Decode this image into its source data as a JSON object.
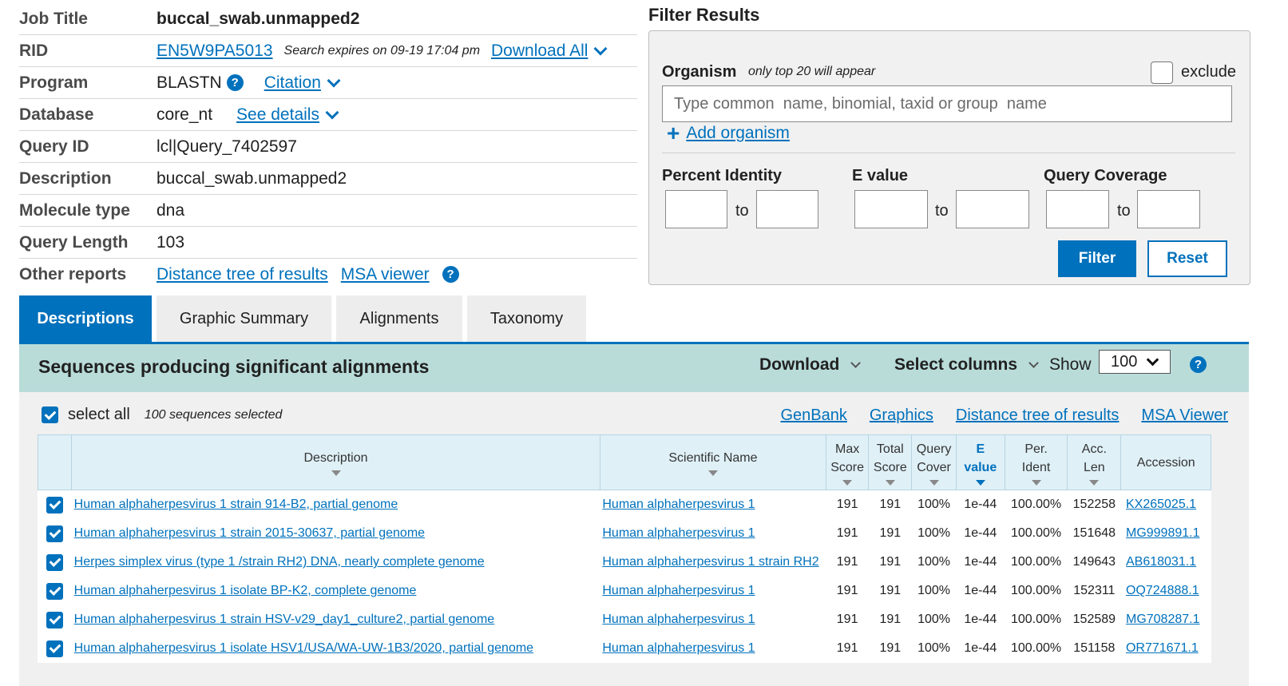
{
  "summary": {
    "job_title_label": "Job Title",
    "job_title": "buccal_swab.unmapped2",
    "rid_label": "RID",
    "rid": "EN5W9PA5013",
    "rid_expires": "Search expires on 09-19 17:04 pm",
    "download_all": "Download All",
    "program_label": "Program",
    "program": "BLASTN",
    "citation": "Citation",
    "database_label": "Database",
    "database": "core_nt",
    "see_details": "See details",
    "query_id_label": "Query ID",
    "query_id": "lcl|Query_7402597",
    "description_label": "Description",
    "description": "buccal_swab.unmapped2",
    "molecule_label": "Molecule type",
    "molecule": "dna",
    "query_length_label": "Query Length",
    "query_length": "103",
    "other_reports_label": "Other reports",
    "distance_tree": "Distance tree of results",
    "msa_viewer": "MSA viewer"
  },
  "filter": {
    "title": "Filter Results",
    "organism_label": "Organism",
    "organism_hint": "only top 20 will appear",
    "exclude_label": "exclude",
    "organism_placeholder": "Type common  name, binomial, taxid or group  name",
    "add_organism": "Add organism",
    "percent_identity": "Percent Identity",
    "e_value": "E value",
    "query_coverage": "Query Coverage",
    "to": "to",
    "filter_button": "Filter",
    "reset_button": "Reset"
  },
  "tabs": [
    {
      "label": "Descriptions",
      "active": true
    },
    {
      "label": "Graphic Summary",
      "active": false
    },
    {
      "label": "Alignments",
      "active": false
    },
    {
      "label": "Taxonomy",
      "active": false
    }
  ],
  "results": {
    "title": "Sequences producing significant alignments",
    "download": "Download",
    "select_columns": "Select columns",
    "show_label": "Show",
    "show_value": "100",
    "select_all": "select all",
    "selected_count": "100 sequences selected",
    "links": [
      "GenBank",
      "Graphics",
      "Distance tree of results",
      "MSA Viewer"
    ],
    "columns": {
      "description": "Description",
      "scientific_name": "Scientific Name",
      "max_score_1": "Max",
      "max_score_2": "Score",
      "total_score_1": "Total",
      "total_score_2": "Score",
      "query_cover_1": "Query",
      "query_cover_2": "Cover",
      "e_value_1": "E",
      "e_value_2": "value",
      "per_ident_1": "Per.",
      "per_ident_2": "Ident",
      "acc_len_1": "Acc.",
      "acc_len_2": "Len",
      "accession": "Accession"
    },
    "rows": [
      {
        "description": "Human alphaherpesvirus 1 strain 914-B2, partial genome",
        "scientific_name": "Human alphaherpesvirus 1",
        "max_score": "191",
        "total_score": "191",
        "query_cover": "100%",
        "e_value": "1e-44",
        "per_ident": "100.00%",
        "acc_len": "152258",
        "accession": "KX265025.1"
      },
      {
        "description": "Human alphaherpesvirus 1 strain 2015-30637, partial genome",
        "scientific_name": "Human alphaherpesvirus 1",
        "max_score": "191",
        "total_score": "191",
        "query_cover": "100%",
        "e_value": "1e-44",
        "per_ident": "100.00%",
        "acc_len": "151648",
        "accession": "MG999891.1"
      },
      {
        "description": "Herpes simplex virus (type 1 /strain RH2) DNA, nearly complete genome",
        "scientific_name": "Human alphaherpesvirus 1 strain RH2",
        "max_score": "191",
        "total_score": "191",
        "query_cover": "100%",
        "e_value": "1e-44",
        "per_ident": "100.00%",
        "acc_len": "149643",
        "accession": "AB618031.1"
      },
      {
        "description": "Human alphaherpesvirus 1 isolate BP-K2, complete genome",
        "scientific_name": "Human alphaherpesvirus 1",
        "max_score": "191",
        "total_score": "191",
        "query_cover": "100%",
        "e_value": "1e-44",
        "per_ident": "100.00%",
        "acc_len": "152311",
        "accession": "OQ724888.1"
      },
      {
        "description": "Human alphaherpesvirus 1 strain HSV-v29_day1_culture2, partial genome",
        "scientific_name": "Human alphaherpesvirus 1",
        "max_score": "191",
        "total_score": "191",
        "query_cover": "100%",
        "e_value": "1e-44",
        "per_ident": "100.00%",
        "acc_len": "152589",
        "accession": "MG708287.1"
      },
      {
        "description": "Human alphaherpesvirus 1 isolate HSV1/USA/WA-UW-1B3/2020, partial genome",
        "scientific_name": "Human alphaherpesvirus 1",
        "max_score": "191",
        "total_score": "191",
        "query_cover": "100%",
        "e_value": "1e-44",
        "per_ident": "100.00%",
        "acc_len": "151158",
        "accession": "OR771671.1"
      }
    ]
  },
  "colors": {
    "link": "#0071bc",
    "header_band": "#b9dcd9",
    "table_header": "#dff0f7",
    "tab_active": "#0071bc"
  }
}
